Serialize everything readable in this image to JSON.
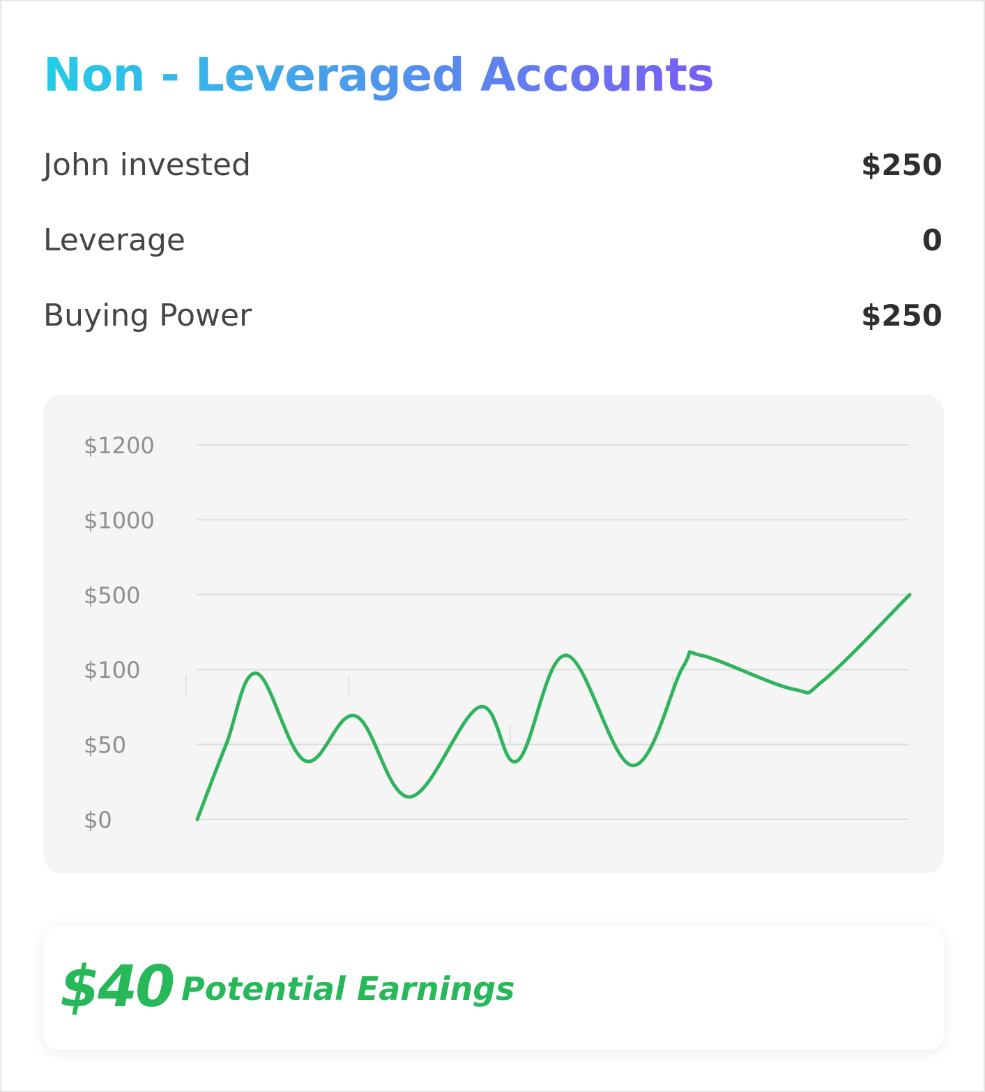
{
  "title": "Non - Leveraged Accounts",
  "stats": [
    {
      "label": "John invested",
      "value": "$250"
    },
    {
      "label": "Leverage",
      "value": "0"
    },
    {
      "label": "Buying Power",
      "value": "$250"
    }
  ],
  "colors": {
    "title_gradient_start": "#22cde6",
    "title_gradient_end": "#7a5cf6",
    "line": "#2fb35c",
    "earnings": "#27b85a"
  },
  "chart_data": {
    "type": "line",
    "y_tick_labels": [
      "$1200",
      "$1000",
      "$500",
      "$100",
      "$50",
      "$0"
    ],
    "y_scale": "categorical-steps",
    "grid": true,
    "series": [
      {
        "values": [
          0,
          33,
          65,
          26,
          46,
          10,
          50,
          26,
          73,
          24,
          68,
          73,
          58,
          62,
          100
        ]
      }
    ]
  },
  "earnings": {
    "amount": "$40",
    "label": "Potential Earnings"
  }
}
